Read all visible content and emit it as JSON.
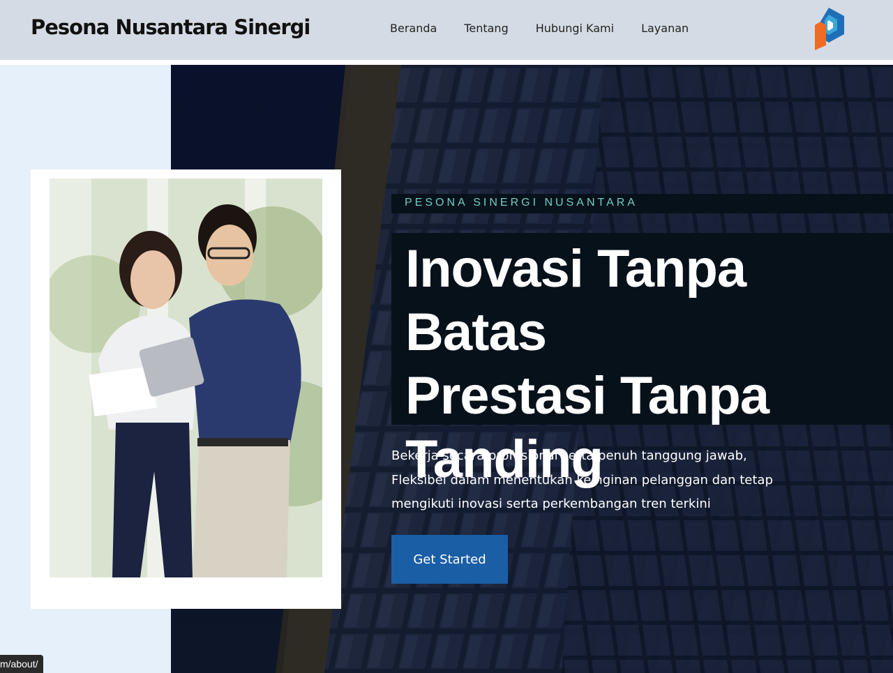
{
  "header": {
    "brand": "Pesona Nusantara Sinergi",
    "nav": [
      "Beranda",
      "Tentang",
      "Hubungi Kami",
      "Layanan"
    ],
    "logo_icon": "ps-logo-icon"
  },
  "hero": {
    "eyebrow": "PESONA SINERGI NUSANTARA",
    "headline_lines": [
      "Inovasi Tanpa Batas",
      "Prestasi Tanpa",
      "Tanding"
    ],
    "description_lines": [
      "Bekerja secara profesional serta penuh tanggung jawab,",
      "Fleksibel dalam menentukan keinginan pelanggan dan tetap",
      "mengikuti inovasi serta perkembangan tren terkini"
    ],
    "cta_label": "Get Started",
    "photo_icon": "business-people-photo"
  },
  "status_bar": {
    "url": "m/about/"
  },
  "colors": {
    "header_bg": "#d5dbe4",
    "accent_blue": "#1a5ea5",
    "eyebrow_teal": "#6fd0c4",
    "dark_panel": "#07111a"
  }
}
